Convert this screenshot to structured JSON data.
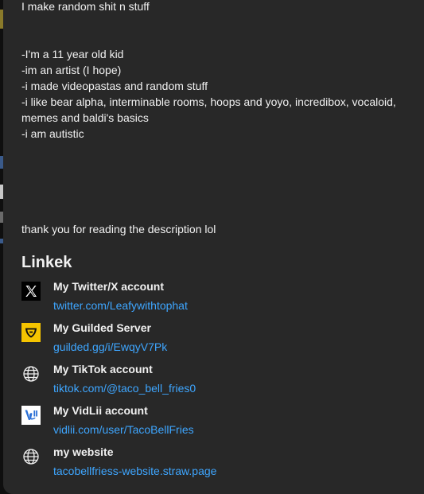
{
  "description": {
    "lines": [
      "I make random shit n stuff",
      "-I'm a 11 year old kid",
      "-im an artist (I hope)",
      "-i made videopastas and random stuff",
      "-i like bear alpha, interminable rooms, hoops and yoyo, incredibox, vocaloid,",
      "memes and baldi's basics",
      "-i am autistic",
      "thank you for reading the description lol"
    ]
  },
  "links": {
    "heading": "Linkek",
    "items": [
      {
        "title": "My Twitter/X account",
        "url": "twitter.com/Leafywithtophat",
        "icon": "x-logo-icon"
      },
      {
        "title": "My Guilded Server",
        "url": "guilded.gg/i/EwqyV7Pk",
        "icon": "guilded-logo-icon"
      },
      {
        "title": "My TikTok account",
        "url": "tiktok.com/@taco_bell_fries0",
        "icon": "globe-icon"
      },
      {
        "title": "My VidLii account",
        "url": "vidlii.com/user/TacoBellFries",
        "icon": "vidlii-logo-icon"
      },
      {
        "title": "my website",
        "url": "tacobellfriess-website.straw.page",
        "icon": "globe-icon"
      }
    ]
  },
  "colors": {
    "panel_bg": "#282828",
    "page_bg": "#0f0f0f",
    "text": "#f1f1f1",
    "link": "#3ea6ff",
    "guilded_yellow": "#f5c400"
  }
}
